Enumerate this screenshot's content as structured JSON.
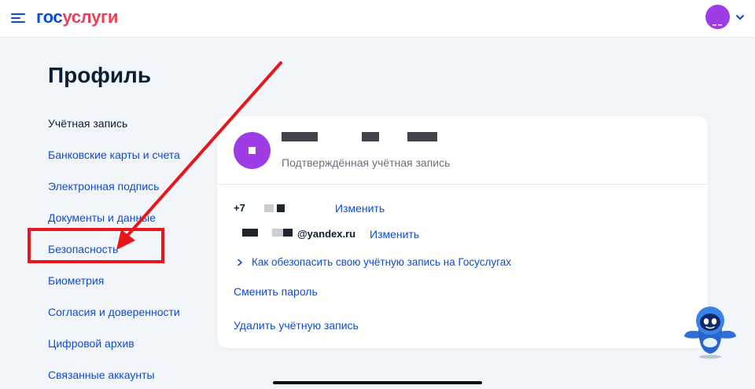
{
  "header": {
    "logo_part1": "гос",
    "logo_part2": "услуги"
  },
  "page": {
    "title": "Профиль"
  },
  "sidebar": {
    "items": [
      {
        "label": "Учётная запись",
        "active": true
      },
      {
        "label": "Банковские карты и счета"
      },
      {
        "label": "Электронная подпись"
      },
      {
        "label": "Документы и данные"
      },
      {
        "label": "Безопасность"
      },
      {
        "label": "Биометрия"
      },
      {
        "label": "Согласия и доверенности"
      },
      {
        "label": "Цифровой архив"
      },
      {
        "label": "Связанные аккаунты"
      }
    ]
  },
  "account": {
    "status": "Подтверждённая учётная запись",
    "phone_prefix": "+7",
    "phone_change": "Изменить",
    "email_suffix": "@yandex.ru",
    "email_change": "Изменить",
    "security_tip": "Как обезопасить свою учётную запись на Госуслугах",
    "change_password": "Сменить пароль",
    "delete_account": "Удалить учётную запись"
  },
  "colors": {
    "brand_blue": "#0d4cd3",
    "brand_red": "#ee3f58",
    "avatar": "#9f3ce6",
    "annotation": "#e8161b"
  },
  "icons": [
    "menu-icon",
    "chevron-down-icon",
    "chevron-right-icon",
    "assistant-robot-icon"
  ]
}
